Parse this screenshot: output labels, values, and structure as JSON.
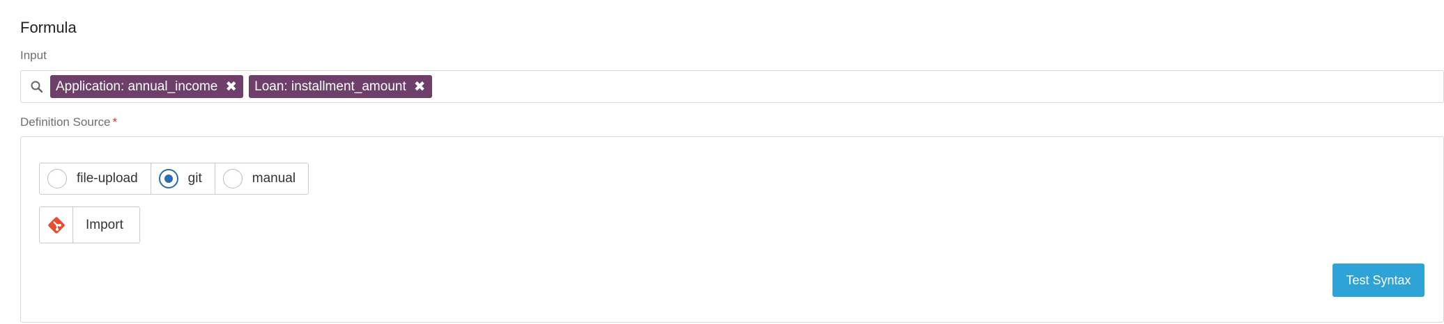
{
  "formula": {
    "title": "Formula",
    "input_label": "Input",
    "tags": [
      {
        "label": "Application: annual_income",
        "remove": "✖"
      },
      {
        "label": "Loan: installment_amount",
        "remove": "✖"
      }
    ],
    "icons": {
      "search": "search-icon",
      "remove": "close-icon",
      "git": "git-icon"
    }
  },
  "definition_source": {
    "label": "Definition Source",
    "required_mark": "*",
    "options": [
      {
        "label": "file-upload",
        "selected": false
      },
      {
        "label": "git",
        "selected": true
      },
      {
        "label": "manual",
        "selected": false
      }
    ],
    "import_label": "Import",
    "test_label": "Test Syntax"
  },
  "colors": {
    "tag_bg": "#6e3f6a",
    "radio_selected": "#2a6bb3",
    "primary_button": "#2ea3d8",
    "git_icon": "#e84d31",
    "required": "#d93025"
  }
}
